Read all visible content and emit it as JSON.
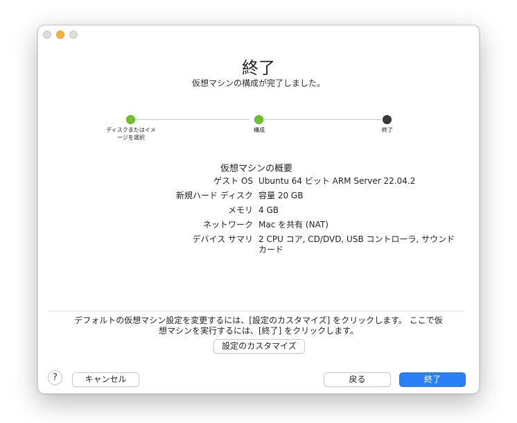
{
  "header": {
    "title": "終了",
    "subtitle": "仮想マシンの構成が完了しました。"
  },
  "stepper": {
    "steps": [
      {
        "label_line1": "ディスクまたはイメ",
        "label_line2": "ージを選択",
        "status": "done"
      },
      {
        "label_line1": "構成",
        "label_line2": "",
        "status": "done"
      },
      {
        "label_line1": "終了",
        "label_line2": "",
        "status": "current"
      }
    ],
    "colors": {
      "done": "#6cc629",
      "current": "#3a3a3a"
    }
  },
  "summary": {
    "title": "仮想マシンの概要",
    "rows": [
      {
        "key": "ゲスト OS",
        "value": "Ubuntu 64 ビット ARM Server 22.04.2"
      },
      {
        "key": "新規ハード ディスク",
        "value": "容量 20 GB"
      },
      {
        "key": "メモリ",
        "value": "4 GB"
      },
      {
        "key": "ネットワーク",
        "value": "Mac を共有 (NAT)"
      },
      {
        "key": "デバイス サマリ",
        "value_line1": "2 CPU コア, CD/DVD, USB コントローラ, サウンド",
        "value_line2": "カード"
      }
    ]
  },
  "note": {
    "line1": "デフォルトの仮想マシン設定を変更するには、[設定のカスタマイズ] をクリックします。 ここで仮",
    "line2": "想マシンを実行するには、[終了] をクリックします。"
  },
  "buttons": {
    "customize": "設定のカスタマイズ",
    "help": "?",
    "cancel": "キャンセル",
    "back": "戻る",
    "finish": "終了"
  },
  "colors": {
    "accent": "#2a7ff5"
  }
}
